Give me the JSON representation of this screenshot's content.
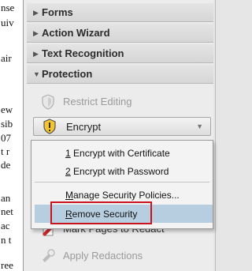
{
  "document": {
    "fragments": [
      "nse",
      "uiv",
      "air",
      "ew",
      "sib",
      "07",
      "t r",
      "de",
      "an",
      "net",
      "ac",
      "n t",
      "ree"
    ]
  },
  "panel": {
    "sections": [
      {
        "label": "Forms",
        "expanded": false
      },
      {
        "label": "Action Wizard",
        "expanded": false
      },
      {
        "label": "Text Recognition",
        "expanded": false
      },
      {
        "label": "Protection",
        "expanded": true
      }
    ],
    "tools": {
      "restrict_editing": "Restrict Editing",
      "encrypt": "Encrypt",
      "mark_pages": "Mark Pages to Redact",
      "apply_redactions": "Apply Redactions"
    }
  },
  "menu": {
    "items": [
      {
        "accel": "1",
        "rest": " Encrypt with Certificate"
      },
      {
        "accel": "2",
        "rest": " Encrypt with Password"
      },
      {
        "accel": "M",
        "rest": "anage Security Policies..."
      },
      {
        "accel": "R",
        "rest": "emove Security",
        "highlighted": true
      }
    ]
  },
  "colors": {
    "highlight": "#b7cde0",
    "annotation_box": "#c8141c"
  }
}
